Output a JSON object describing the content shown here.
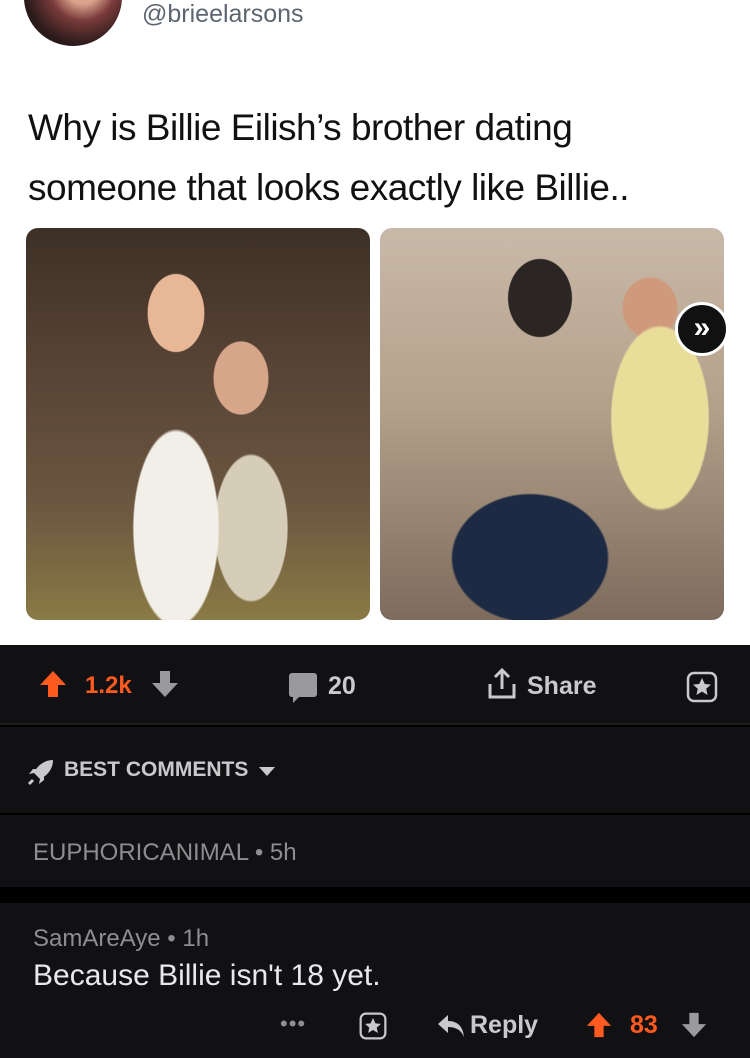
{
  "tweet": {
    "handle": "@brieelarsons",
    "text": "Why is Billie Eilish’s brother dating someone that looks exactly like Billie.."
  },
  "actions": {
    "score": "1.2k",
    "comments": "20",
    "share_label": "Share",
    "accent_color": "#ff5a1f"
  },
  "sort": {
    "label": "BEST COMMENTS"
  },
  "comments": [
    {
      "author": "EUPHORICANIMAL",
      "time": "5h",
      "text": ""
    },
    {
      "author": "SamAreAye",
      "time": "1h",
      "text": "Because Billie isn't 18 yet.",
      "score": "83",
      "reply_label": "Reply"
    }
  ]
}
